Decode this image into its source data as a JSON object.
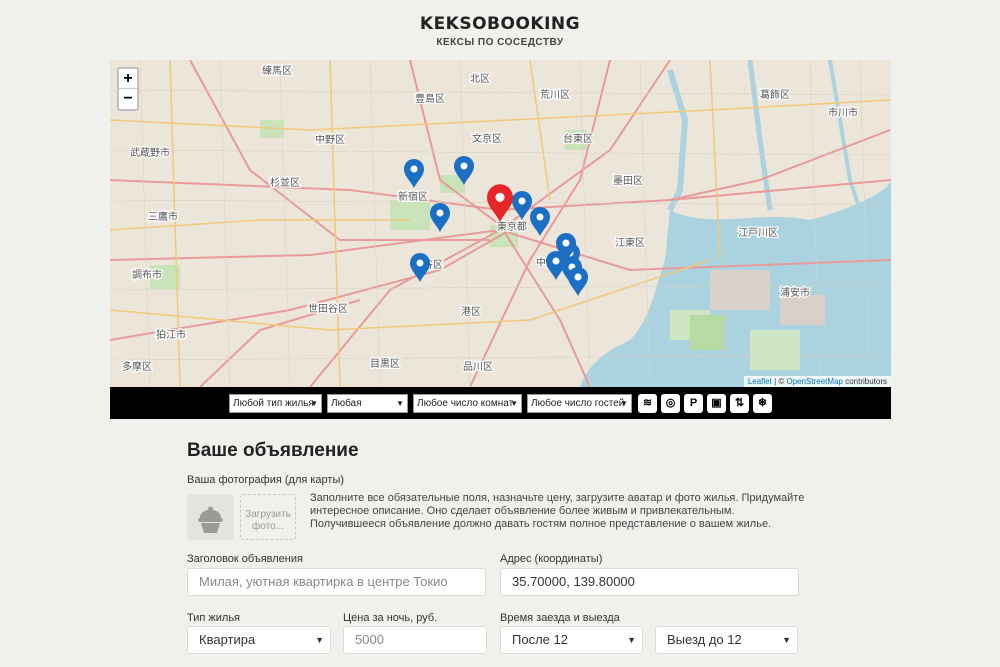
{
  "header": {
    "title": "KEKSOBOOKING",
    "subtitle": "КЕКСЫ ПО СОСЕДСТВУ"
  },
  "map": {
    "zoom_in": "+",
    "zoom_out": "−",
    "attribution": {
      "leaflet": "Leaflet",
      "separator": " | © ",
      "osm": "OpenStreetMap",
      "suffix": " contributors"
    },
    "labels": [
      "練馬区",
      "豊島区",
      "荒川区",
      "葛飾区",
      "北区",
      "中野区",
      "文京区",
      "台東区",
      "市川市",
      "武蔵野市",
      "新宿区",
      "墨田区",
      "杉並区",
      "三鷹市",
      "東京都",
      "江東区",
      "江戸川区",
      "渋谷区",
      "中央区",
      "調布市",
      "世田谷区",
      "港区",
      "浦安市",
      "狛江市",
      "目黒区",
      "品川区",
      "多摩区"
    ],
    "main_pin_color": "#e8262a",
    "pin_color": "#1b6fc4"
  },
  "filters": {
    "type": "Любой тип жилья",
    "price": "Любая",
    "rooms": "Любое число комнат",
    "guests": "Любое число гостей",
    "features": [
      "wifi-icon",
      "dishwasher-icon",
      "parking-icon",
      "washer-icon",
      "elevator-icon",
      "conditioner-icon"
    ],
    "feature_glyphs": [
      "≋",
      "◎",
      "P",
      "▣",
      "⇅",
      "❄"
    ]
  },
  "form": {
    "title": "Ваше объявление",
    "photo_label": "Ваша фотография (для карты)",
    "upload_label": "Загрузить фото...",
    "description": "Заполните все обязательные поля, назначьте цену, загрузите аватар и фото жилья. Придумайте интересное описание. Оно сделает объявление более живым и привлекательным. Получившееся объявление должно давать гостям полное представление о вашем жилье.",
    "title_label": "Заголовок объявления",
    "title_placeholder": "Милая, уютная квартирка в центре Токио",
    "address_label": "Адрес (координаты)",
    "address_value": "35.70000, 139.80000",
    "type_label": "Тип жилья",
    "type_value": "Квартира",
    "price_label": "Цена за ночь, руб.",
    "price_placeholder": "5000",
    "time_label": "Время заезда и выезда",
    "checkin_value": "После 12",
    "checkout_value": "Выезд до 12"
  }
}
